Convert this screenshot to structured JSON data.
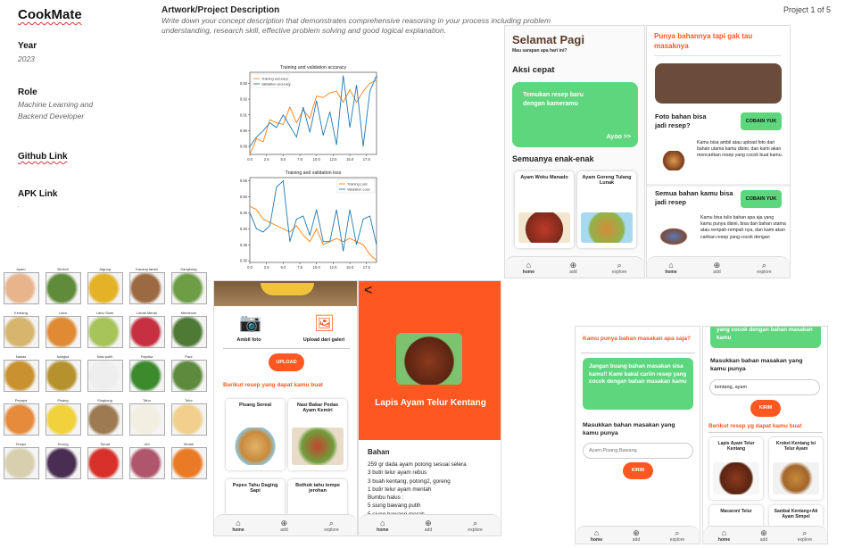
{
  "left": {
    "app_title": "CookMate",
    "year_label": "Year",
    "year_value": "2023",
    "role_label": "Role",
    "role_value_1": "Machine Learning and",
    "role_value_2": "Backend Developer",
    "github_label": "Github Link",
    "apk_label": "APK Link",
    "apk_value": "."
  },
  "header": {
    "title": "Artwork/Project Description",
    "description": "Write down your concept description that demonstrates comprehensive reasoning in your process including problem understanding, research skill, effective problem solving and good logical explanation.",
    "counter": "Project 1 of 5"
  },
  "chart_data": [
    {
      "type": "line",
      "title": "Training and validation accuracy",
      "x": [
        0,
        1,
        2,
        3,
        4,
        5,
        6,
        7,
        8,
        9,
        10,
        11,
        12,
        13,
        14,
        15,
        16,
        17,
        18,
        19
      ],
      "series": [
        {
          "name": "Training accuracy",
          "color": "#ff7f0e",
          "values": [
            0.885,
            0.895,
            0.893,
            0.907,
            0.905,
            0.904,
            0.915,
            0.905,
            0.913,
            0.908,
            0.922,
            0.921,
            0.924,
            0.925,
            0.918,
            0.926,
            0.918,
            0.925,
            0.93,
            0.932
          ]
        },
        {
          "name": "Validation accuracy",
          "color": "#1f77b4",
          "values": [
            0.89,
            0.896,
            0.9,
            0.905,
            0.902,
            0.91,
            0.903,
            0.896,
            0.915,
            0.899,
            0.919,
            0.897,
            0.912,
            0.891,
            0.935,
            0.902,
            0.929,
            0.89,
            0.925,
            0.935
          ]
        }
      ],
      "xticks": [
        "0.0",
        "2.5",
        "5.0",
        "7.5",
        "10.0",
        "12.5",
        "15.0",
        "17.5"
      ],
      "yticks": [
        "0.89",
        "0.90",
        "0.91",
        "0.92",
        "0.93"
      ],
      "xlim": [
        0,
        19
      ],
      "ylim": [
        0.885,
        0.937
      ],
      "legend": "top-left"
    },
    {
      "type": "line",
      "title": "Training and validation loss",
      "x": [
        0,
        1,
        2,
        3,
        4,
        5,
        6,
        7,
        8,
        9,
        10,
        11,
        12,
        13,
        14,
        15,
        16,
        17,
        18,
        19
      ],
      "series": [
        {
          "name": "Training Loss",
          "color": "#ff7f0e",
          "values": [
            0.47,
            0.46,
            0.43,
            0.42,
            0.41,
            0.4,
            0.39,
            0.41,
            0.38,
            0.36,
            0.4,
            0.35,
            0.36,
            0.37,
            0.36,
            0.37,
            0.36,
            0.35,
            0.32,
            0.3
          ]
        },
        {
          "name": "Validation Loss",
          "color": "#1f77b4",
          "values": [
            0.45,
            0.4,
            0.39,
            0.41,
            0.53,
            0.55,
            0.36,
            0.43,
            0.44,
            0.38,
            0.46,
            0.36,
            0.36,
            0.46,
            0.33,
            0.46,
            0.35,
            0.43,
            0.44,
            0.35
          ]
        }
      ],
      "xticks": [
        "0.0",
        "2.5",
        "5.0",
        "7.5",
        "10.0",
        "12.5",
        "15.0",
        "17.5"
      ],
      "yticks": [
        "0.30",
        "0.35",
        "0.40",
        "0.45",
        "0.50",
        "0.55"
      ],
      "xlim": [
        0,
        19
      ],
      "ylim": [
        0.295,
        0.56
      ],
      "legend": "top-right"
    }
  ],
  "foods": [
    {
      "name": "Ayam",
      "color": "#e8b48c"
    },
    {
      "name": "Brokoli",
      "color": "#5f8b3b"
    },
    {
      "name": "Jagung",
      "color": "#e3b227"
    },
    {
      "name": "Kacang tanah",
      "color": "#9b6a42"
    },
    {
      "name": "Kangkung",
      "color": "#6d9e46"
    },
    {
      "name": "Kentang",
      "color": "#d6b56c"
    },
    {
      "name": "Labu",
      "color": "#e08b33"
    },
    {
      "name": "Labu Siam",
      "color": "#a7c45a"
    },
    {
      "name": "Lobak Merah",
      "color": "#c63040"
    },
    {
      "name": "Mentimun",
      "color": "#4f7a36"
    },
    {
      "name": "Nanas",
      "color": "#c9922e"
    },
    {
      "name": "Nangka",
      "color": "#b6922f"
    },
    {
      "name": "Nasi putih",
      "color": "#eeeeee"
    },
    {
      "name": "Paprika",
      "color": "#3b8a2c"
    },
    {
      "name": "Pare",
      "color": "#5d8a3c"
    },
    {
      "name": "Pepaya",
      "color": "#e68a3c"
    },
    {
      "name": "Pisang",
      "color": "#f1d23c"
    },
    {
      "name": "Singkong",
      "color": "#9d7a52"
    },
    {
      "name": "Tahu",
      "color": "#f2efe2"
    },
    {
      "name": "Telur",
      "color": "#f0d08c"
    },
    {
      "name": "Tempe",
      "color": "#d7cfae"
    },
    {
      "name": "Terong",
      "color": "#4a2d52"
    },
    {
      "name": "Tomat",
      "color": "#d8312a"
    },
    {
      "name": "Ubi",
      "color": "#b0566c"
    },
    {
      "name": "Wortel",
      "color": "#ea7a26"
    }
  ],
  "phone1": {
    "greeting": "Selamat Pagi",
    "subtitle": "Mau sarapan apa hari ini?",
    "section_quick": "Aksi cepat",
    "camera_text": "Temukan resep baru dengan kameramu",
    "camera_link": "Ayoo >>",
    "section_all": "Semuanya enak-enak",
    "card1": "Ayam Woku Manado",
    "card2": "Ayam Goreng Tulang Lunak",
    "nav": [
      "home",
      "add",
      "explore"
    ]
  },
  "phone2": {
    "heading": "Punya bahannya tapi gak tau masaknya",
    "photo_title": "Foto bahan bisa jadi resep?",
    "photo_btn": "COBAIN YUK",
    "photo_desc": "Kamu bisa ambil atau upload foto dari bahan utama kamu disini, dan kami akan mencarikan resep yang cocok buat kamu.",
    "text_title": "Semua bahan kamu bisa jadi resep",
    "text_btn": "COBAIN YUK",
    "text_desc": "Kamu bisa tulis bahan apa aja yang kamu punya disini, bisa dari bahan utama atau rempah-rempah nya, dan kami akan carikan resep yang cocok dengan",
    "nav": [
      "home",
      "add",
      "explore"
    ]
  },
  "phone3": {
    "take_photo": "Ambil foto",
    "upload_gallery": "Upload dari galeri",
    "upload_btn": "UPLOAD",
    "result_heading": "Berikut resep yang dapat kamu buat",
    "card1": "Pisang Sereal",
    "card2": "Nasi Bakar Pedas Ayam Kemiri",
    "card3": "Pepes Tahu Daging Sapi",
    "card4": "Bothok tahu tempe jerohan",
    "nav": [
      "home",
      "add",
      "explore"
    ]
  },
  "phone4": {
    "back": "<",
    "recipe_title": "Lapis Ayam Telur Kentang",
    "ingredients_heading": "Bahan",
    "ingredients": [
      "259 gr dada ayam potong sesuai selera",
      "3 butir telur ayam rebus",
      "3 buah kentang, potong2, goreng",
      "1 butir telur ayam mentah",
      "Bumbu halus :",
      "5 siung bawang putih",
      "5 siung bawang merah"
    ],
    "nav": [
      "home",
      "add",
      "explore"
    ]
  },
  "phone5": {
    "heading": "Kamu punya bahan masakan apa saja?",
    "bubble": "Jangan buang bahan masakan sisa kamu!! Kami bakal cariin resep yang cocok dengan bahan masakan kamu",
    "input_label": "Masukkan bahan masakan yang kamu punya",
    "input_placeholder": "Ayam,Pisang,Bawang",
    "submit": "KIRIM",
    "nav": [
      "home",
      "add",
      "explore"
    ]
  },
  "phone6": {
    "bubble_tail": "yang cocok dengan bahan masakan kamu",
    "input_label": "Masukkan bahan masakan yang kamu punya",
    "input_value": "kentang, ayam",
    "submit": "KIRIM",
    "result_heading": "Berikut resep yg dapat kamu buat",
    "card1": "Lapis Ayam Telur Kentang",
    "card2": "Kroket Kentang Isi Telur Ayam",
    "card3": "Macaroni Telur",
    "card4": "Sambal Kentang+Ati Ayam Simpel",
    "nav": [
      "home",
      "add",
      "explore"
    ]
  }
}
